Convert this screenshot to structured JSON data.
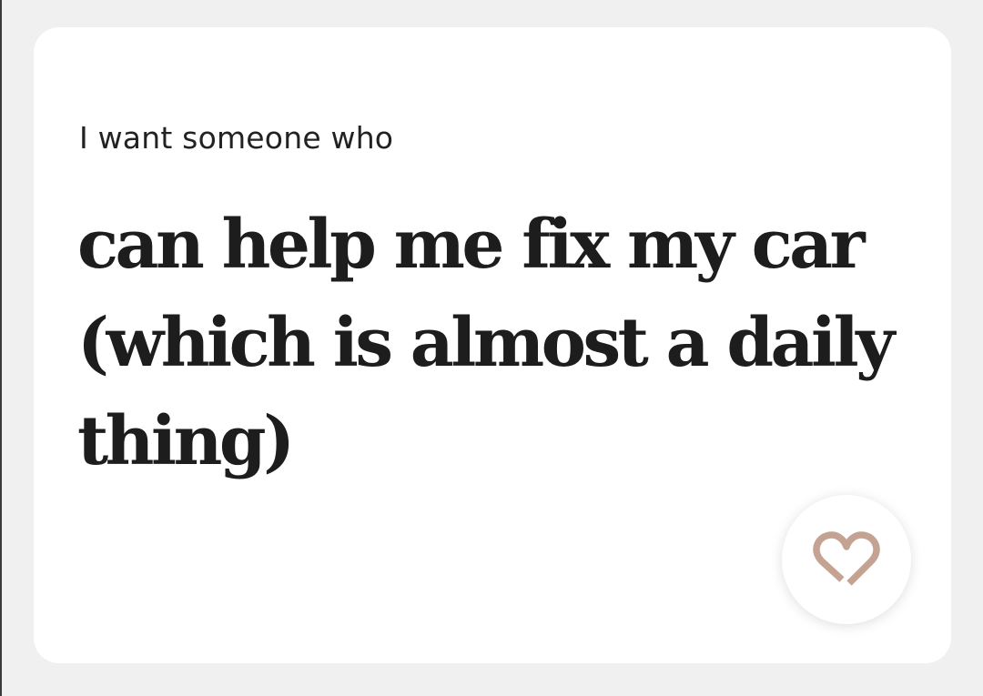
{
  "prompt": {
    "question": "I want someone who",
    "answer": "can help me fix my car (which is almost a daily thing)"
  },
  "like_button": {
    "icon": "heart-icon",
    "icon_color": "#c4a393"
  },
  "colors": {
    "background": "#f0f0f0",
    "card": "#ffffff",
    "text": "#1d1d1d"
  }
}
